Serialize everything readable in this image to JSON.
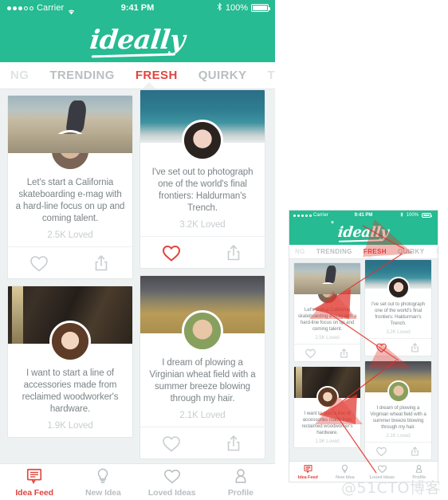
{
  "app": {
    "brand": "ideally",
    "accent_green": "#26bb92",
    "accent_red": "#e0453f",
    "muted_gray": "#b9bfc1"
  },
  "status_bar": {
    "carrier": "Carrier",
    "time": "9:41 PM",
    "battery_percent": "100%",
    "signal_filled_dots": 3,
    "signal_empty_dots": 2,
    "wifi_icon": "wifi-icon",
    "bluetooth_icon": "bluetooth-icon",
    "battery_icon": "battery-full-icon"
  },
  "category_tabs": [
    {
      "label": "NG",
      "state": "cut-off"
    },
    {
      "label": "TRENDING",
      "state": "inactive"
    },
    {
      "label": "FRESH",
      "state": "active"
    },
    {
      "label": "QUIRKY",
      "state": "inactive"
    },
    {
      "label": "TECH",
      "state": "dim"
    }
  ],
  "feed": {
    "left_column": [
      {
        "id": "card-skateboarding",
        "photo": "skateboarding-photo",
        "avatar": "avatar-man-bald",
        "text": "Let's start a California skateboarding e-mag with a hard-line focus on up and coming talent.",
        "loved": "2.5K Loved",
        "love_icon": "heart-icon",
        "share_icon": "share-icon",
        "loved_active": false
      },
      {
        "id": "card-woodworker",
        "photo": "workshop-tools-photo",
        "avatar": "avatar-woman-brunette",
        "text": "I want to start a line of accessories made from reclaimed woodworker's hardware.",
        "loved": "1.9K Loved",
        "love_icon": "heart-icon",
        "share_icon": "share-icon",
        "loved_active": false
      }
    ],
    "right_column": [
      {
        "id": "card-photography",
        "photo": "ocean-beach-photo",
        "avatar": "avatar-woman-headband",
        "text": "I've set out to photograph one of the world's final frontiers: Haldurman's Trench.",
        "loved": "3.2K Loved",
        "love_icon": "heart-icon",
        "share_icon": "share-icon",
        "loved_active": true
      },
      {
        "id": "card-wheatfield",
        "photo": "wheat-field-photo",
        "avatar": "avatar-man-smiling",
        "text": "I dream of plowing a Virginian wheat field with a summer breeze blowing through my hair.",
        "loved": "2.1K Loved",
        "love_icon": "heart-icon",
        "share_icon": "share-icon",
        "loved_active": false
      }
    ]
  },
  "bottom_tabs": [
    {
      "label": "Idea Feed",
      "icon": "speech-bubble-lines-icon",
      "active": true
    },
    {
      "label": "New Idea",
      "icon": "lightbulb-icon",
      "active": false
    },
    {
      "label": "Loved Ideas",
      "icon": "heart-icon",
      "active": false
    },
    {
      "label": "Profile",
      "icon": "person-icon",
      "active": false
    }
  ],
  "watermark": "@51CTO博客"
}
